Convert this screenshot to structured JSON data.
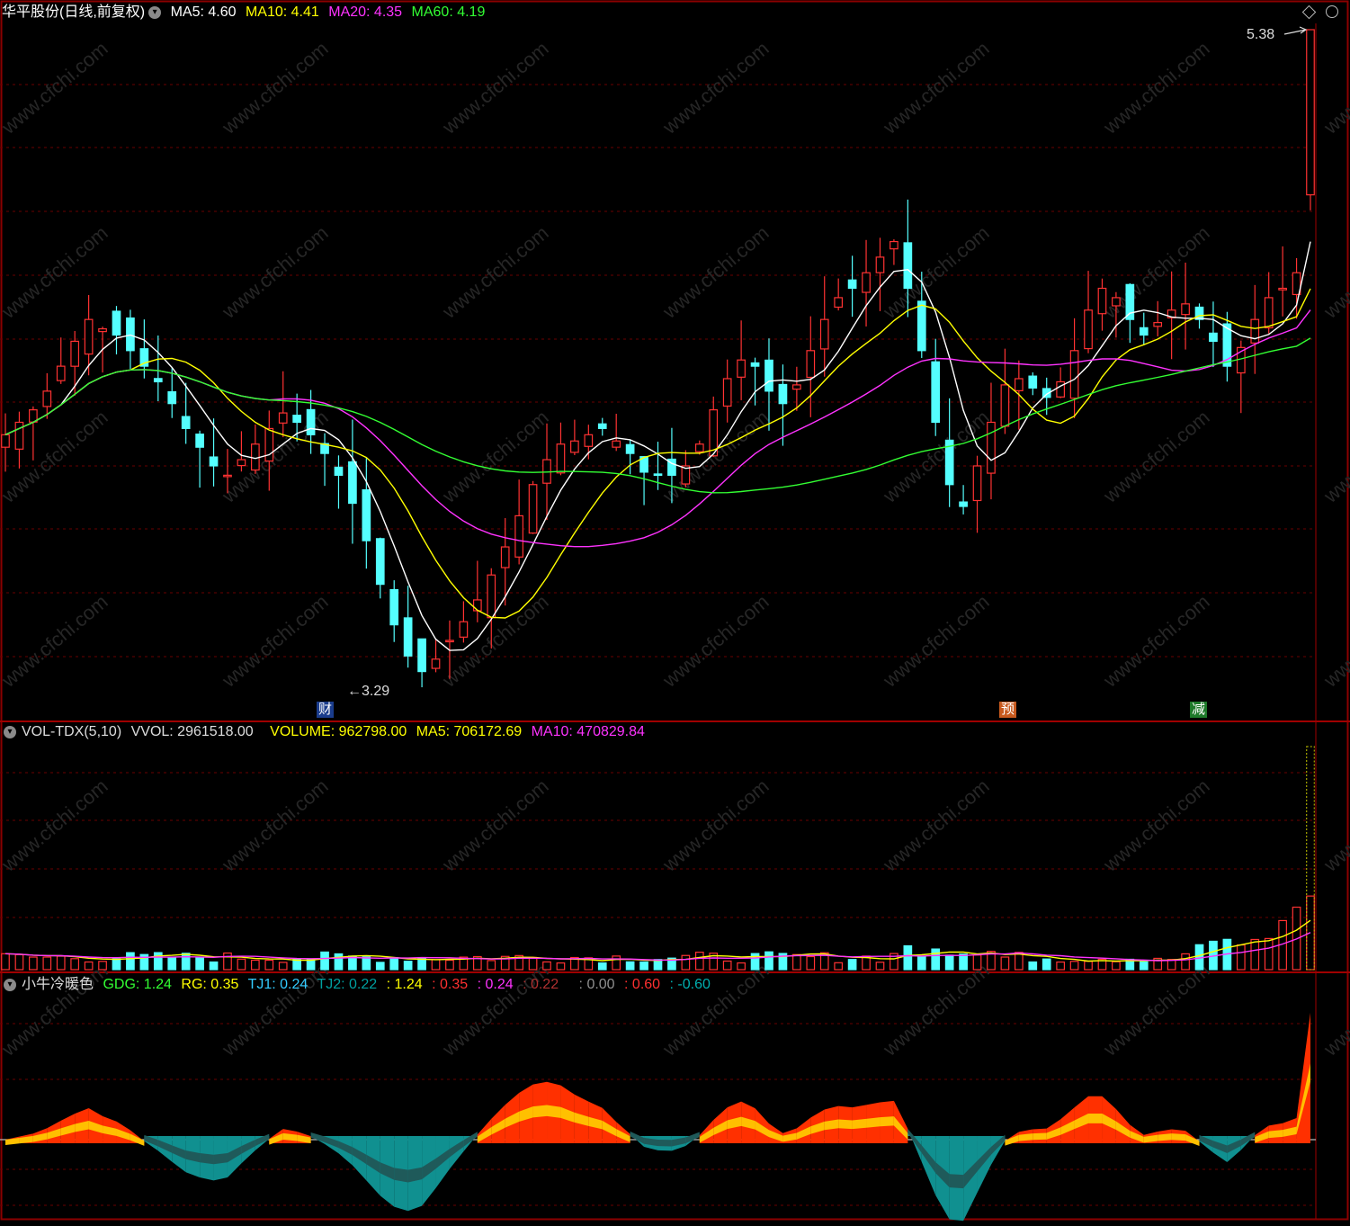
{
  "price_panel": {
    "title": "华平股份(日线,前复权)",
    "ma5": "MA5: 4.60",
    "ma10": "MA10: 4.41",
    "ma20": "MA20: 4.35",
    "ma60": "MA60: 4.19",
    "high_mark": "5.38",
    "low_mark": "←3.29"
  },
  "volume_panel": {
    "title": "VOL-TDX(5,10)",
    "vvol": "VVOL: 2961518.00",
    "volume": "VOLUME: 962798.00",
    "ma5": "MA5: 706172.69",
    "ma10": "MA10: 470829.84"
  },
  "indicator_panel": {
    "title": "小牛冷暖色",
    "gdg": "GDG: 1.24",
    "rg": "RG: 0.35",
    "tj1": "TJ1: 0.24",
    "tj2": "TJ2: 0.22",
    "v1": ": 1.24",
    "v2": ": 0.35",
    "v3": ": 0.24",
    "v4": ": 0.22",
    "v5": ": 0.00",
    "v6": ": 0.60",
    "v7": ": -0.60"
  },
  "events": [
    "财",
    "预",
    "减"
  ],
  "watermark": "www.cfchi.com",
  "colors": {
    "up": "#ff3232",
    "down": "#54ffff",
    "ma5": "#ffffff",
    "ma10": "#ffff00",
    "ma20": "#ff33ff",
    "ma60": "#33ff33",
    "warm": "#ff3000",
    "cold": "#109090",
    "grid": "#8b0000"
  },
  "chart_data": {
    "type": "candlestick",
    "price_range": [
      3.29,
      5.38
    ],
    "last_close": 5.38,
    "low_point": 3.29,
    "high_point": 5.38,
    "close_series": [
      4.08,
      4.12,
      4.16,
      4.22,
      4.3,
      4.38,
      4.45,
      4.42,
      4.4,
      4.35,
      4.3,
      4.25,
      4.18,
      4.1,
      4.04,
      3.98,
      3.95,
      4.0,
      4.05,
      4.1,
      4.15,
      4.12,
      4.08,
      4.02,
      3.95,
      3.86,
      3.74,
      3.6,
      3.47,
      3.37,
      3.32,
      3.36,
      3.42,
      3.48,
      3.55,
      3.63,
      3.72,
      3.82,
      3.92,
      4.0,
      4.05,
      4.06,
      4.08,
      4.1,
      4.06,
      4.02,
      3.96,
      3.95,
      3.95,
      3.98,
      4.05,
      4.16,
      4.26,
      4.32,
      4.3,
      4.22,
      4.18,
      4.24,
      4.35,
      4.45,
      4.52,
      4.55,
      4.6,
      4.65,
      4.7,
      4.55,
      4.35,
      4.12,
      3.92,
      3.85,
      3.98,
      4.12,
      4.24,
      4.26,
      4.23,
      4.2,
      4.25,
      4.35,
      4.48,
      4.55,
      4.52,
      4.45,
      4.4,
      4.44,
      4.48,
      4.5,
      4.45,
      4.38,
      4.3,
      4.36,
      4.45,
      4.52,
      4.55,
      4.6,
      5.38
    ],
    "volume_peak": 2961518.0,
    "indicator_zero_line": 0.0
  }
}
